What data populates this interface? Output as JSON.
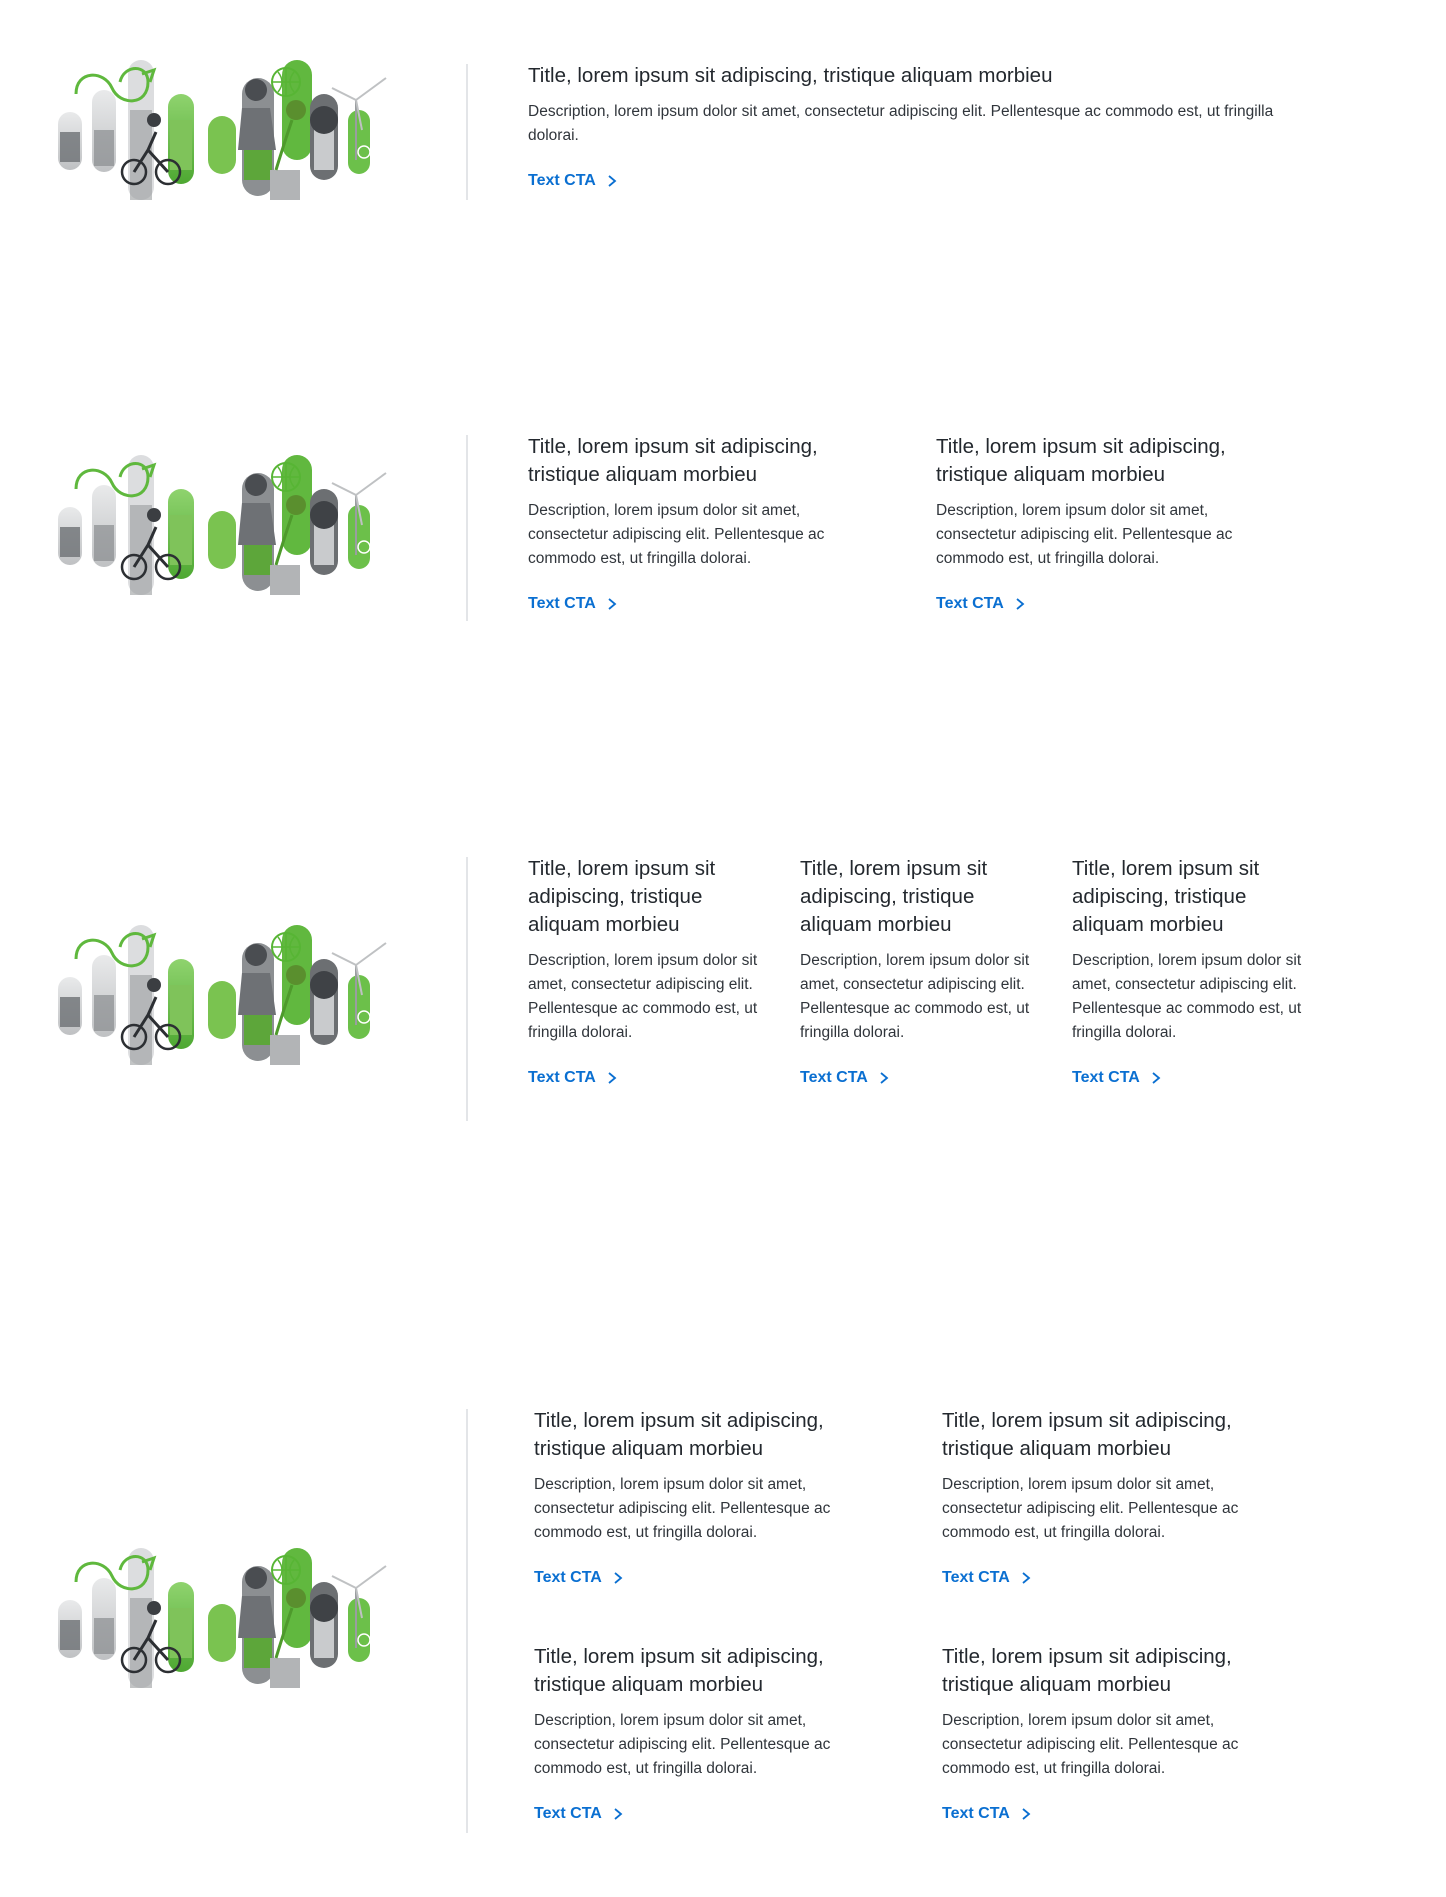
{
  "colors": {
    "accent_green": "#6cc04a",
    "cta_blue": "#0a6fd1",
    "divider": "#e3e5e8",
    "text": "#23282e"
  },
  "illustration": {
    "name": "sustainability-collage",
    "icons": [
      "infinity-arrow-icon",
      "cyclist-image",
      "plants-image",
      "person-gardening-image",
      "globe-icon",
      "child-image",
      "wind-turbine-icon"
    ]
  },
  "cta_icon": "chevron-right-icon",
  "sections": [
    {
      "id": "one-column",
      "cards": [
        {
          "title": "Title, lorem ipsum sit adipiscing, tristique aliquam morbieu",
          "description": "Description, lorem ipsum dolor sit amet, consectetur adipiscing elit. Pellentesque ac commodo est, ut fringilla dolorai.",
          "cta": "Text CTA"
        }
      ]
    },
    {
      "id": "two-column",
      "cards": [
        {
          "title": "Title, lorem ipsum sit adipiscing, tristique aliquam morbieu",
          "description": "Description, lorem ipsum dolor sit amet, consectetur adipiscing elit. Pellentesque ac commodo est, ut fringilla dolorai.",
          "cta": "Text CTA"
        },
        {
          "title": "Title, lorem ipsum sit adipiscing, tristique aliquam morbieu",
          "description": "Description, lorem ipsum dolor sit amet, consectetur adipiscing elit. Pellentesque ac commodo est, ut fringilla dolorai.",
          "cta": "Text CTA"
        }
      ]
    },
    {
      "id": "three-column",
      "cards": [
        {
          "title": "Title, lorem ipsum sit adipiscing, tristique aliquam morbieu",
          "description": "Description, lorem ipsum dolor sit amet, consectetur adipiscing elit. Pellentesque ac commodo est, ut fringilla dolorai.",
          "cta": "Text CTA"
        },
        {
          "title": "Title, lorem ipsum sit adipiscing, tristique aliquam morbieu",
          "description": "Description, lorem ipsum dolor sit amet, consectetur adipiscing elit. Pellentesque ac commodo est, ut fringilla dolorai.",
          "cta": "Text CTA"
        },
        {
          "title": "Title, lorem ipsum sit adipiscing, tristique aliquam morbieu",
          "description": "Description, lorem ipsum dolor sit amet, consectetur adipiscing elit. Pellentesque ac commodo est, ut fringilla dolorai.",
          "cta": "Text CTA"
        }
      ]
    },
    {
      "id": "two-by-two-grid",
      "cards": [
        {
          "title": "Title, lorem ipsum sit adipiscing, tristique aliquam morbieu",
          "description": "Description, lorem ipsum dolor sit amet, consectetur adipiscing elit. Pellentesque ac commodo est, ut fringilla dolorai.",
          "cta": "Text CTA"
        },
        {
          "title": "Title, lorem ipsum sit adipiscing, tristique aliquam morbieu",
          "description": "Description, lorem ipsum dolor sit amet, consectetur adipiscing elit. Pellentesque ac commodo est, ut fringilla dolorai.",
          "cta": "Text CTA"
        },
        {
          "title": "Title, lorem ipsum sit adipiscing, tristique aliquam morbieu",
          "description": "Description, lorem ipsum dolor sit amet, consectetur adipiscing elit. Pellentesque ac commodo est, ut fringilla dolorai.",
          "cta": "Text CTA"
        },
        {
          "title": "Title, lorem ipsum sit adipiscing, tristique aliquam morbieu",
          "description": "Description, lorem ipsum dolor sit amet, consectetur adipiscing elit. Pellentesque ac commodo est, ut fringilla dolorai.",
          "cta": "Text CTA"
        }
      ]
    }
  ]
}
